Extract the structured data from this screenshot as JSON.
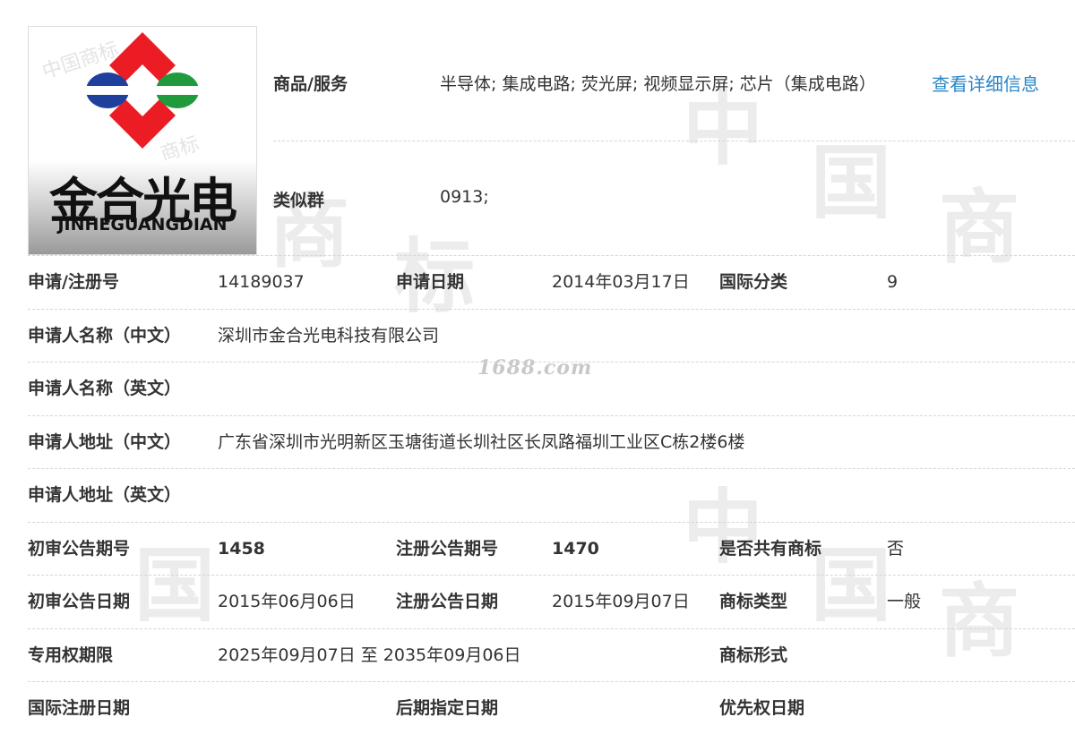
{
  "watermark": {
    "site": "1688.com",
    "chars": [
      "中",
      "国",
      "商",
      "标"
    ]
  },
  "logo": {
    "brand_cn": "金合光电",
    "brand_en": "JINHEGUANGDIAN",
    "colors": {
      "red": "#ec1c24",
      "blue": "#1f3f9c",
      "green": "#1f9a3c"
    }
  },
  "goods": {
    "label": "商品/服务",
    "value": "半导体; 集成电路; 荧光屏; 视频显示屏; 芯片（集成电路）",
    "link": "查看详细信息"
  },
  "similar": {
    "label": "类似群",
    "value": "0913;"
  },
  "rows": {
    "r1": {
      "l1": "申请/注册号",
      "v1": "14189037",
      "l2": "申请日期",
      "v2": "2014年03月17日",
      "l3": "国际分类",
      "v3": "9"
    },
    "r2": {
      "l1": "申请人名称（中文）",
      "v1": "深圳市金合光电科技有限公司"
    },
    "r3": {
      "l1": "申请人名称（英文）",
      "v1": ""
    },
    "r4": {
      "l1": "申请人地址（中文）",
      "v1": "广东省深圳市光明新区玉塘街道长圳社区长凤路福圳工业区C栋2楼6楼"
    },
    "r5": {
      "l1": "申请人地址（英文）",
      "v1": ""
    },
    "r6": {
      "l1": "初审公告期号",
      "v1": "1458",
      "l2": "注册公告期号",
      "v2": "1470",
      "l3": "是否共有商标",
      "v3": "否"
    },
    "r7": {
      "l1": "初审公告日期",
      "v1": "2015年06月06日",
      "l2": "注册公告日期",
      "v2": "2015年09月07日",
      "l3": "商标类型",
      "v3": "一般"
    },
    "r8": {
      "l1": "专用权期限",
      "v1": "2025年09月07日 至 2035年09月06日",
      "l3": "商标形式",
      "v3": ""
    },
    "r9": {
      "l1": "国际注册日期",
      "v1": "",
      "l2": "后期指定日期",
      "v2": "",
      "l3": "优先权日期",
      "v3": ""
    }
  }
}
